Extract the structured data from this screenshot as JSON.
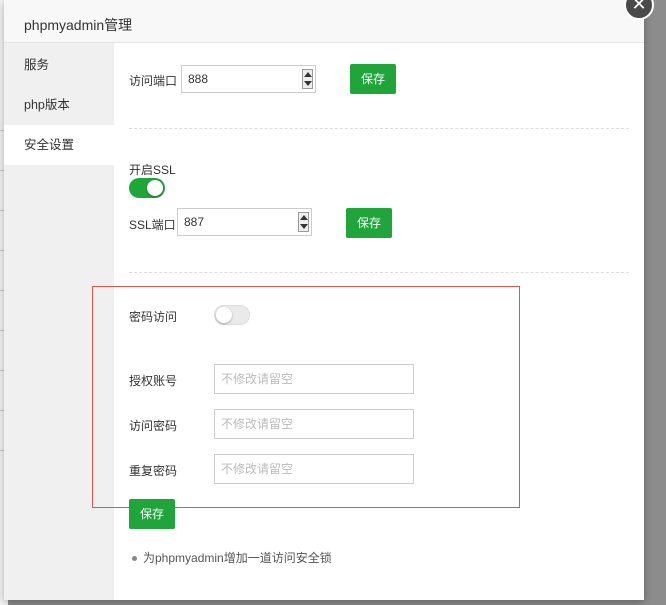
{
  "dialog": {
    "title": "phpmyadmin管理",
    "close_icon": "close-icon"
  },
  "sidebar": {
    "items": [
      {
        "label": "服务",
        "active": false
      },
      {
        "label": "php版本",
        "active": false
      },
      {
        "label": "安全设置",
        "active": true
      }
    ]
  },
  "port_section": {
    "label": "访问端口",
    "value": "888",
    "save_label": "保存"
  },
  "ssl_section": {
    "label": "开启SSL",
    "enabled": true,
    "port_label": "SSL端口",
    "port_value": "887",
    "save_label": "保存"
  },
  "password_section": {
    "label": "密码访问",
    "enabled": false,
    "account_label": "授权账号",
    "account_placeholder": "不修改请留空",
    "password_label": "访问密码",
    "password_placeholder": "不修改请留空",
    "repeat_label": "重复密码",
    "repeat_placeholder": "不修改请留空",
    "save_label": "保存"
  },
  "note": {
    "text": "为phpmyadmin增加一道访问安全锁"
  },
  "colors": {
    "accent": "#20a53a",
    "highlight_border": "#e0564b"
  }
}
